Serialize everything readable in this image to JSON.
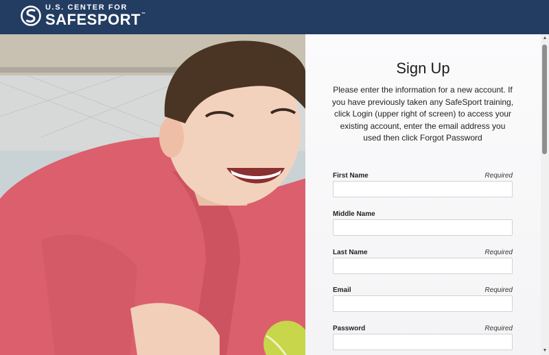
{
  "header": {
    "logo_line1": "U.S. CENTER FOR",
    "logo_line2": "SAFESPORT",
    "logo_tm": "™",
    "logo_icon": "safesport-s-logo-icon",
    "background_color": "#233c61"
  },
  "hero": {
    "image": "smiling-boy-tennis-photo"
  },
  "signup": {
    "title": "Sign Up",
    "intro": "Please enter the information for a new account. If you have previously taken any SafeSport training, click Login (upper right of screen) to access your existing account, enter the email address you used then click Forgot Password",
    "fields": [
      {
        "label": "First Name",
        "required": "Required",
        "value": ""
      },
      {
        "label": "Middle Name",
        "required": "",
        "value": ""
      },
      {
        "label": "Last Name",
        "required": "Required",
        "value": ""
      },
      {
        "label": "Email",
        "required": "Required",
        "value": ""
      },
      {
        "label": "Password",
        "required": "Required",
        "value": ""
      }
    ]
  },
  "scrollbar": {
    "up_icon": "scroll-up-arrow-icon",
    "down_icon": "scroll-down-arrow-icon"
  }
}
